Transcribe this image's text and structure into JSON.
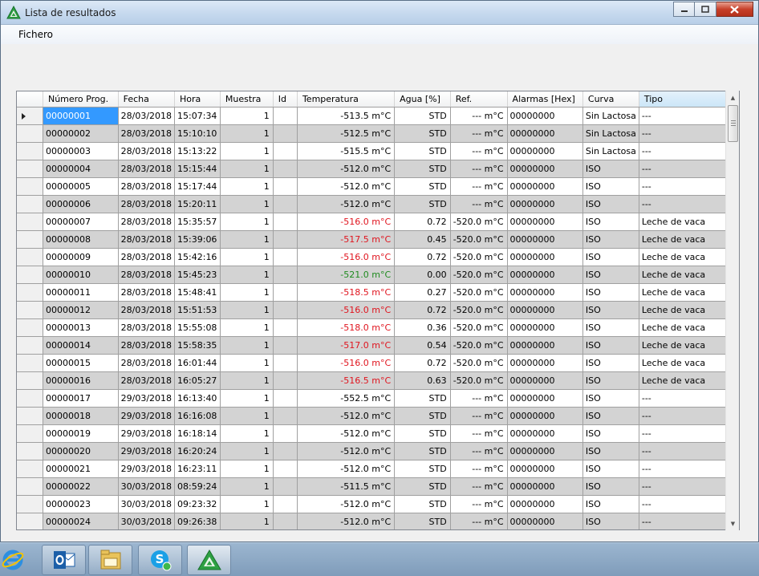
{
  "window": {
    "title": "Lista de resultados"
  },
  "menu": {
    "items": [
      "Fichero"
    ]
  },
  "table": {
    "columns": [
      "Número Prog.",
      "Fecha",
      "Hora",
      "Muestra",
      "Id",
      "Temperatura",
      "Agua [%]",
      "Ref.",
      "Alarmas [Hex]",
      "Curva",
      "Tipo"
    ],
    "rows": [
      [
        "00000001",
        "28/03/2018",
        "15:07:34",
        "1",
        "",
        "-513.5 m°C",
        "STD",
        "--- m°C",
        "00000000",
        "Sin Lactosa",
        "---"
      ],
      [
        "00000002",
        "28/03/2018",
        "15:10:10",
        "1",
        "",
        "-512.5 m°C",
        "STD",
        "--- m°C",
        "00000000",
        "Sin Lactosa",
        "---"
      ],
      [
        "00000003",
        "28/03/2018",
        "15:13:22",
        "1",
        "",
        "-515.5 m°C",
        "STD",
        "--- m°C",
        "00000000",
        "Sin Lactosa",
        "---"
      ],
      [
        "00000004",
        "28/03/2018",
        "15:15:44",
        "1",
        "",
        "-512.0 m°C",
        "STD",
        "--- m°C",
        "00000000",
        "ISO",
        "---"
      ],
      [
        "00000005",
        "28/03/2018",
        "15:17:44",
        "1",
        "",
        "-512.0 m°C",
        "STD",
        "--- m°C",
        "00000000",
        "ISO",
        "---"
      ],
      [
        "00000006",
        "28/03/2018",
        "15:20:11",
        "1",
        "",
        "-512.0 m°C",
        "STD",
        "--- m°C",
        "00000000",
        "ISO",
        "---"
      ],
      [
        "00000007",
        "28/03/2018",
        "15:35:57",
        "1",
        "",
        "-516.0 m°C",
        "0.72",
        "-520.0 m°C",
        "00000000",
        "ISO",
        "Leche de vaca"
      ],
      [
        "00000008",
        "28/03/2018",
        "15:39:06",
        "1",
        "",
        "-517.5 m°C",
        "0.45",
        "-520.0 m°C",
        "00000000",
        "ISO",
        "Leche de vaca"
      ],
      [
        "00000009",
        "28/03/2018",
        "15:42:16",
        "1",
        "",
        "-516.0 m°C",
        "0.72",
        "-520.0 m°C",
        "00000000",
        "ISO",
        "Leche de vaca"
      ],
      [
        "00000010",
        "28/03/2018",
        "15:45:23",
        "1",
        "",
        "-521.0 m°C",
        "0.00",
        "-520.0 m°C",
        "00000000",
        "ISO",
        "Leche de vaca"
      ],
      [
        "00000011",
        "28/03/2018",
        "15:48:41",
        "1",
        "",
        "-518.5 m°C",
        "0.27",
        "-520.0 m°C",
        "00000000",
        "ISO",
        "Leche de vaca"
      ],
      [
        "00000012",
        "28/03/2018",
        "15:51:53",
        "1",
        "",
        "-516.0 m°C",
        "0.72",
        "-520.0 m°C",
        "00000000",
        "ISO",
        "Leche de vaca"
      ],
      [
        "00000013",
        "28/03/2018",
        "15:55:08",
        "1",
        "",
        "-518.0 m°C",
        "0.36",
        "-520.0 m°C",
        "00000000",
        "ISO",
        "Leche de vaca"
      ],
      [
        "00000014",
        "28/03/2018",
        "15:58:35",
        "1",
        "",
        "-517.0 m°C",
        "0.54",
        "-520.0 m°C",
        "00000000",
        "ISO",
        "Leche de vaca"
      ],
      [
        "00000015",
        "28/03/2018",
        "16:01:44",
        "1",
        "",
        "-516.0 m°C",
        "0.72",
        "-520.0 m°C",
        "00000000",
        "ISO",
        "Leche de vaca"
      ],
      [
        "00000016",
        "28/03/2018",
        "16:05:27",
        "1",
        "",
        "-516.5 m°C",
        "0.63",
        "-520.0 m°C",
        "00000000",
        "ISO",
        "Leche de vaca"
      ],
      [
        "00000017",
        "29/03/2018",
        "16:13:40",
        "1",
        "",
        "-552.5 m°C",
        "STD",
        "--- m°C",
        "00000000",
        "ISO",
        "---"
      ],
      [
        "00000018",
        "29/03/2018",
        "16:16:08",
        "1",
        "",
        "-512.0 m°C",
        "STD",
        "--- m°C",
        "00000000",
        "ISO",
        "---"
      ],
      [
        "00000019",
        "29/03/2018",
        "16:18:14",
        "1",
        "",
        "-512.0 m°C",
        "STD",
        "--- m°C",
        "00000000",
        "ISO",
        "---"
      ],
      [
        "00000020",
        "29/03/2018",
        "16:20:24",
        "1",
        "",
        "-512.0 m°C",
        "STD",
        "--- m°C",
        "00000000",
        "ISO",
        "---"
      ],
      [
        "00000021",
        "29/03/2018",
        "16:23:11",
        "1",
        "",
        "-512.0 m°C",
        "STD",
        "--- m°C",
        "00000000",
        "ISO",
        "---"
      ],
      [
        "00000022",
        "30/03/2018",
        "08:59:24",
        "1",
        "",
        "-511.5 m°C",
        "STD",
        "--- m°C",
        "00000000",
        "ISO",
        "---"
      ],
      [
        "00000023",
        "30/03/2018",
        "09:23:32",
        "1",
        "",
        "-512.0 m°C",
        "STD",
        "--- m°C",
        "00000000",
        "ISO",
        "---"
      ],
      [
        "00000024",
        "30/03/2018",
        "09:26:38",
        "1",
        "",
        "-512.0 m°C",
        "STD",
        "--- m°C",
        "00000000",
        "ISO",
        "---"
      ]
    ],
    "temperature_colors": [
      "",
      "",
      "",
      "",
      "",
      "",
      "red",
      "red",
      "red",
      "green",
      "red",
      "red",
      "red",
      "red",
      "red",
      "red",
      "",
      "",
      "",
      "",
      "",
      "",
      "",
      ""
    ],
    "selected_row": 0
  },
  "colors": {
    "red": "#e0141e",
    "green": "#1f8a1f",
    "selection": "#3399ff",
    "alt_row": "#d3d3d3"
  },
  "taskbar": {
    "icons": [
      "internet-explorer-icon",
      "outlook-icon",
      "file-explorer-icon",
      "skype-icon",
      "app-logo-icon"
    ]
  }
}
